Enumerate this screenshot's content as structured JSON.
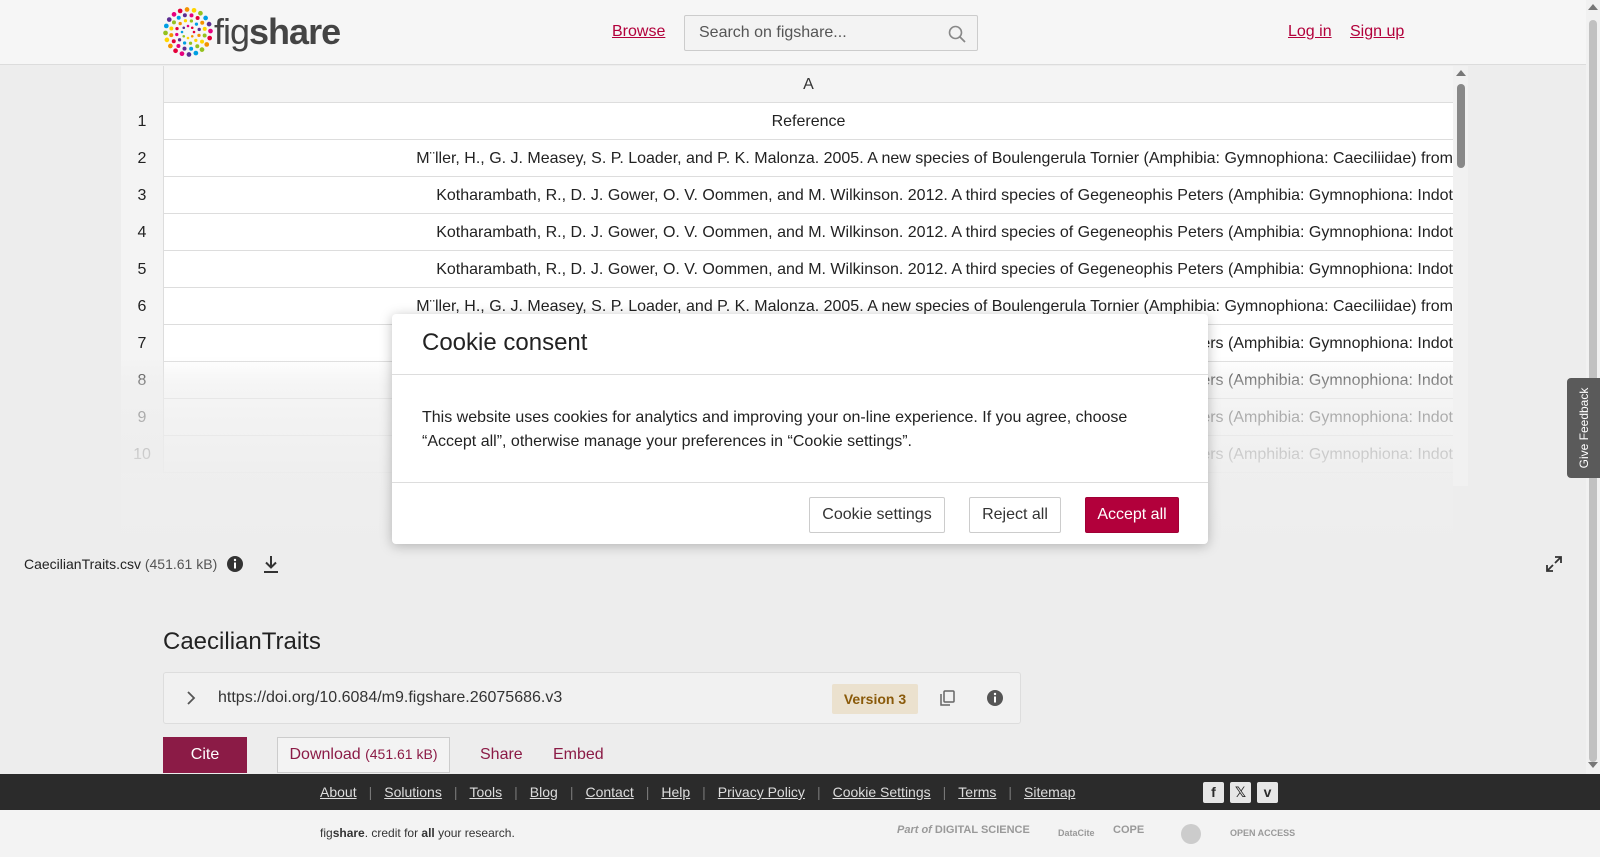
{
  "header": {
    "logo_fig": "fig",
    "logo_share": "share",
    "browse": "Browse",
    "search_placeholder": "Search on figshare...",
    "login": "Log in",
    "signup": "Sign up"
  },
  "sheet": {
    "column_header": "A",
    "rows": [
      {
        "num": "1",
        "text": "Reference",
        "align": "center"
      },
      {
        "num": "2",
        "text": "M¨ller, H., G. J. Measey, S. P. Loader, and P. K. Malonza. 2005. A new species of Boulengerula Tornier (Amphibia: Gymnophiona: Caeciliidae) from",
        "align": "right"
      },
      {
        "num": "3",
        "text": "Kotharambath, R., D. J. Gower, O. V. Oommen, and M. Wilkinson. 2012. A third species of Gegeneophis Peters (Amphibia: Gymnophiona: Indot",
        "align": "right"
      },
      {
        "num": "4",
        "text": "Kotharambath, R., D. J. Gower, O. V. Oommen, and M. Wilkinson. 2012. A third species of Gegeneophis Peters (Amphibia: Gymnophiona: Indot",
        "align": "right"
      },
      {
        "num": "5",
        "text": "Kotharambath, R., D. J. Gower, O. V. Oommen, and M. Wilkinson. 2012. A third species of Gegeneophis Peters (Amphibia: Gymnophiona: Indot",
        "align": "right"
      },
      {
        "num": "6",
        "text": "M¨ller, H., G. J. Measey, S. P. Loader, and P. K. Malonza. 2005. A new species of Boulengerula Tornier (Amphibia: Gymnophiona: Caeciliidae) from",
        "align": "right"
      },
      {
        "num": "7",
        "text": "ers (Amphibia: Gymnophiona: Indot",
        "align": "right"
      },
      {
        "num": "8",
        "text": "ers (Amphibia: Gymnophiona: Indot",
        "align": "right"
      },
      {
        "num": "9",
        "text": "ers (Amphibia: Gymnophiona: Indot",
        "align": "right"
      },
      {
        "num": "10",
        "text": "ers (Amphibia: Gymnophiona: Indot",
        "align": "right"
      }
    ]
  },
  "file": {
    "name": "CaecilianTraits.csv",
    "size": "(451.61 kB)"
  },
  "item": {
    "title": "CaecilianTraits",
    "doi": "https://doi.org/10.6084/m9.figshare.26075686.v3",
    "version": "Version 3",
    "cite": "Cite",
    "download": "Download",
    "download_size": "(451.61 kB)",
    "share": "Share",
    "embed": "Embed"
  },
  "cookie": {
    "title": "Cookie consent",
    "body": "This website uses cookies for analytics and improving your on-line experience. If you agree, choose “Accept all”, otherwise manage your preferences in “Cookie settings”.",
    "settings": "Cookie settings",
    "reject": "Reject all",
    "accept": "Accept all"
  },
  "feedback": "Give Feedback",
  "footer": {
    "links": [
      "About",
      "Solutions",
      "Tools",
      "Blog",
      "Contact",
      "Help",
      "Privacy Policy",
      "Cookie Settings",
      "Terms",
      "Sitemap"
    ],
    "social": [
      "facebook-icon",
      "x-icon",
      "vimeo-icon"
    ],
    "tagline_fig": "fig",
    "tagline_share": "share",
    "tagline_mid": ". credit for ",
    "tagline_all": "all",
    "tagline_end": " your research.",
    "partner_part_of": "Part of",
    "partner_ds": "DIGITAL SCIENCE",
    "partner_datacite": "DataCite",
    "partner_cope": "COPE",
    "partner_oa": "OPEN ACCESS"
  },
  "colors": {
    "brand": "#b2003b",
    "cite_bg": "#8b1b46",
    "footer_bg": "#2b2b2b"
  }
}
